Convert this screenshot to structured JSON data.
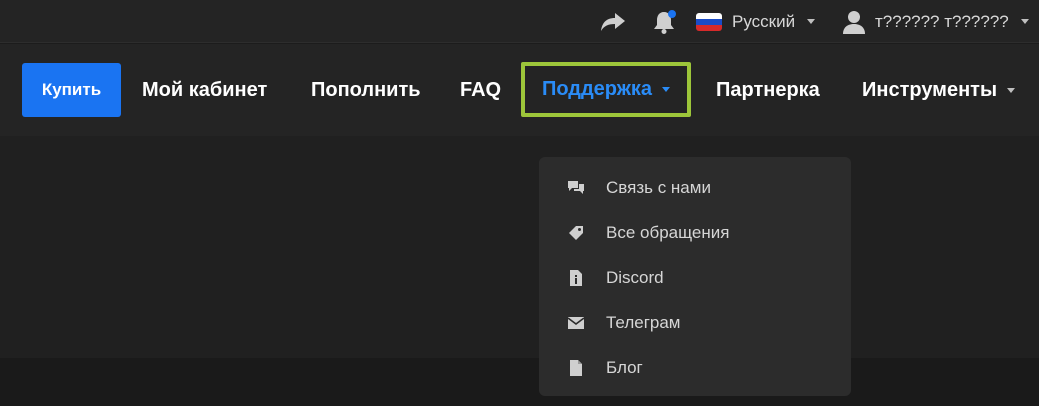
{
  "topbar": {
    "share_icon": "share-icon",
    "bell_icon": "bell-icon",
    "language": "Русский",
    "user_name": "т?????? т??????"
  },
  "nav": {
    "buy": "Купить",
    "cabinet": "Мой кабинет",
    "topup": "Пополнить",
    "faq": "FAQ",
    "support": "Поддержка",
    "partner": "Партнерка",
    "tools": "Инструменты"
  },
  "dropdown": {
    "items": [
      {
        "label": "Связь с нами",
        "icon": "chat-icon"
      },
      {
        "label": "Все обращения",
        "icon": "tag-icon"
      },
      {
        "label": "Discord",
        "icon": "document-info-icon"
      },
      {
        "label": "Телеграм",
        "icon": "envelope-icon"
      },
      {
        "label": "Блог",
        "icon": "file-icon"
      }
    ]
  },
  "colors": {
    "accent_blue": "#1a74f2",
    "support_text": "#2a8cf7",
    "highlight_border": "#9dc63a"
  }
}
